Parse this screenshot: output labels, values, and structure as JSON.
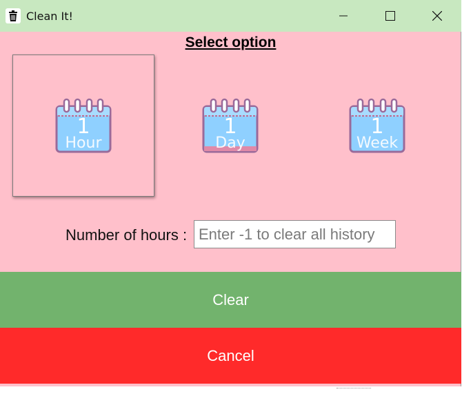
{
  "window": {
    "title": "Clean It!",
    "app_icon": "trash-icon",
    "controls": [
      "minimize-icon",
      "maximize-icon",
      "close-icon"
    ]
  },
  "heading": "Select option",
  "options": [
    {
      "number": "1",
      "unit": "Hour",
      "selected": true,
      "icon": "calendar-icon"
    },
    {
      "number": "1",
      "unit": "Day",
      "selected": false,
      "icon": "calendar-icon"
    },
    {
      "number": "1",
      "unit": "Week",
      "selected": false,
      "icon": "calendar-icon"
    }
  ],
  "hours": {
    "label": "Number of hours :",
    "value": "",
    "placeholder": "Enter -1 to clear all history"
  },
  "buttons": {
    "clear_label": "Clear",
    "cancel_label": "Cancel"
  },
  "colors": {
    "titlebar": "#c8e8c0",
    "background": "#ffc0cb",
    "clear": "#72b36d",
    "cancel": "#ff2a2a"
  }
}
